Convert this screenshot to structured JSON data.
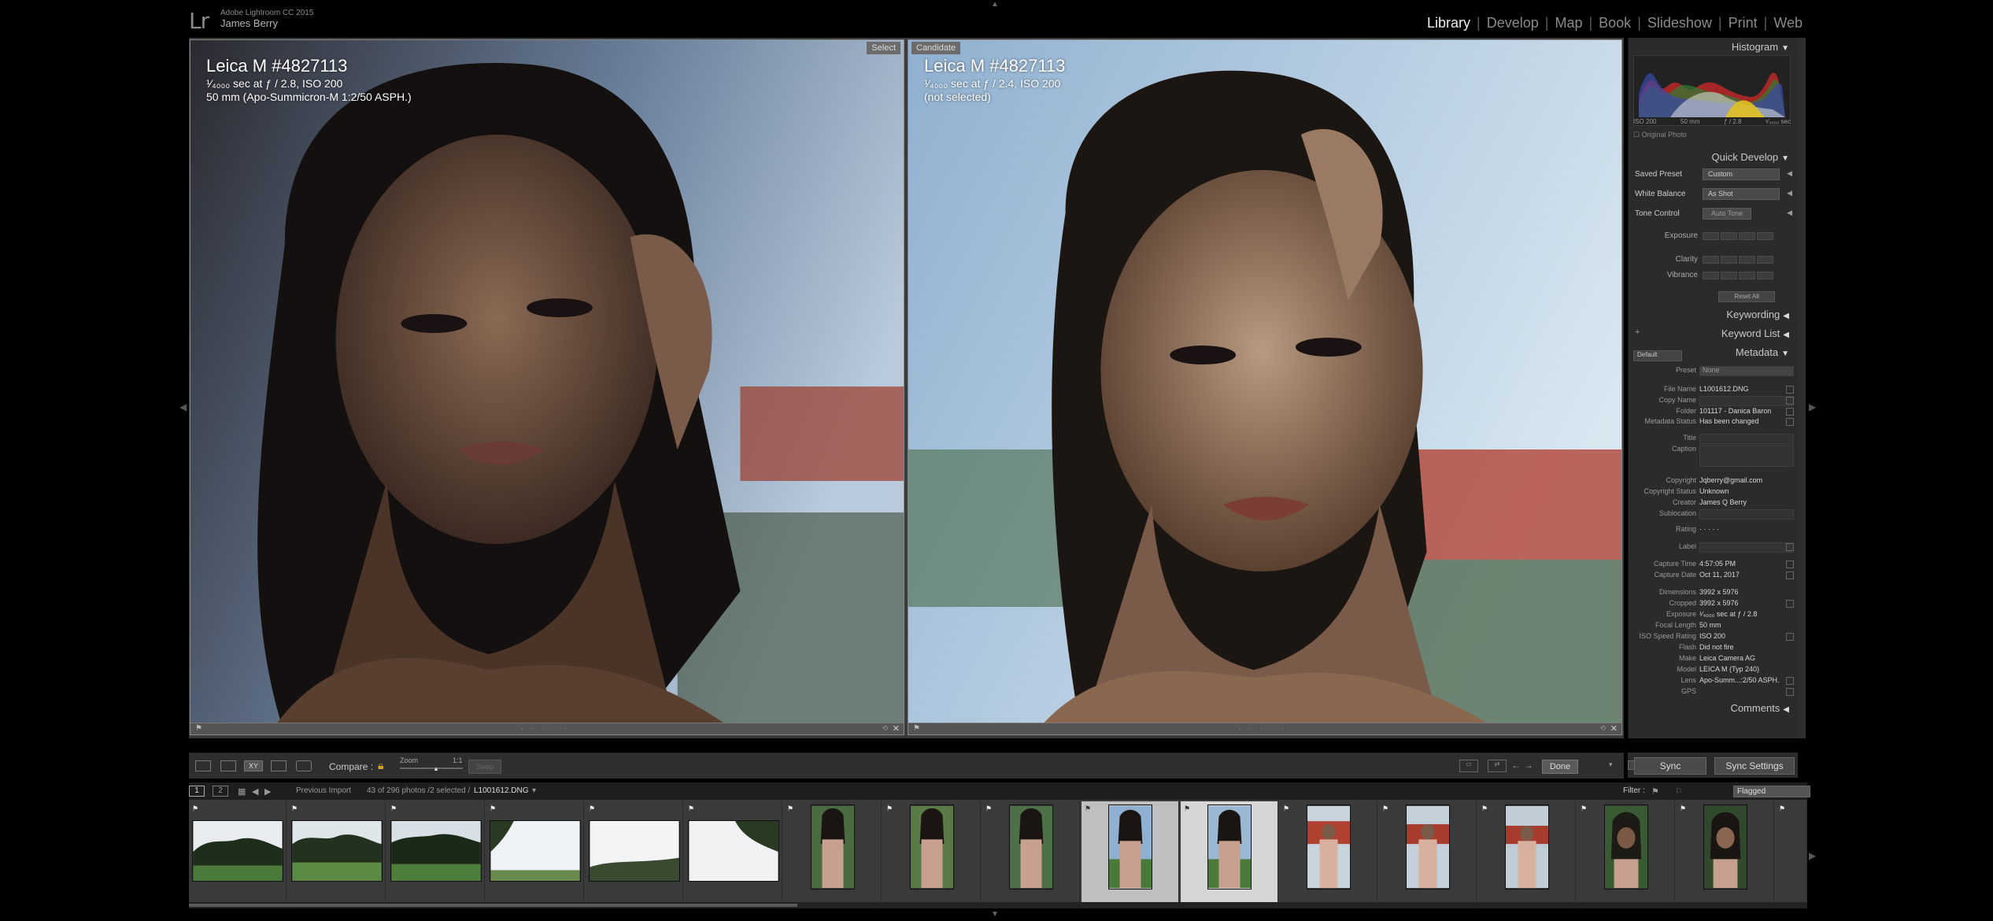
{
  "app": {
    "logo": "Lr",
    "name": "Adobe Lightroom CC 2015",
    "user": "James Berry"
  },
  "modules": [
    "Library",
    "Develop",
    "Map",
    "Book",
    "Slideshow",
    "Print",
    "Web"
  ],
  "active_module": "Library",
  "select_pane": {
    "tag": "Select",
    "camera": "Leica M #4827113",
    "exposure_line": "¹⁄₄₀₀₀ sec at ƒ / 2.8, ISO 200",
    "lens_line": "50 mm (Apo-Summicron-M 1:2/50 ASPH.)"
  },
  "candidate_pane": {
    "tag": "Candidate",
    "camera": "Leica M #4827113",
    "exposure_line": "¹⁄₄₀₀₀ sec at ƒ / 2.4, ISO 200",
    "status_line": "(not selected)"
  },
  "toolbar": {
    "compare_label": "Compare :",
    "zoom_label": "Zoom",
    "zoom_value": "1:1",
    "swap_label": "Swap",
    "done_label": "Done"
  },
  "right_panel": {
    "histogram": {
      "title": "Histogram",
      "iso": "ISO 200",
      "focal": "50 mm",
      "aperture": "ƒ / 2.8",
      "shutter": "¹⁄₄₀₀₀ sec",
      "original_photo": "Original Photo"
    },
    "quick_develop": {
      "title": "Quick Develop",
      "saved_preset_label": "Saved Preset",
      "saved_preset_value": "Custom",
      "white_balance_label": "White Balance",
      "white_balance_value": "As Shot",
      "tone_control_label": "Tone Control",
      "auto_tone": "Auto Tone",
      "exposure_label": "Exposure",
      "clarity_label": "Clarity",
      "vibrance_label": "Vibrance",
      "reset_all": "Reset All"
    },
    "keywording_title": "Keywording",
    "keyword_list_title": "Keyword List",
    "metadata": {
      "title": "Metadata",
      "preset_select": "Default",
      "preset_label": "Preset",
      "preset_value": "None",
      "fields": [
        {
          "k": "File Name",
          "v": "L1001612.DNG"
        },
        {
          "k": "Copy Name",
          "v": ""
        },
        {
          "k": "Folder",
          "v": "101117 - Danica Baron"
        },
        {
          "k": "Metadata Status",
          "v": "Has been changed"
        },
        {
          "k": "Title",
          "v": ""
        },
        {
          "k": "Caption",
          "v": ""
        },
        {
          "k": "Copyright",
          "v": "Jqberry@gmail.com"
        },
        {
          "k": "Copyright Status",
          "v": "Unknown"
        },
        {
          "k": "Creator",
          "v": "James Q Berry"
        },
        {
          "k": "Sublocation",
          "v": ""
        },
        {
          "k": "Rating",
          "v": "· · · · ·"
        },
        {
          "k": "Label",
          "v": ""
        },
        {
          "k": "Capture Time",
          "v": "4:57:05 PM"
        },
        {
          "k": "Capture Date",
          "v": "Oct 11, 2017"
        },
        {
          "k": "Dimensions",
          "v": "3992 x 5976"
        },
        {
          "k": "Cropped",
          "v": "3992 x 5976"
        },
        {
          "k": "Exposure",
          "v": "¹⁄₄₀₀₀ sec at ƒ / 2.8"
        },
        {
          "k": "Focal Length",
          "v": "50 mm"
        },
        {
          "k": "ISO Speed Rating",
          "v": "ISO 200"
        },
        {
          "k": "Flash",
          "v": "Did not fire"
        },
        {
          "k": "Make",
          "v": "Leica Camera AG"
        },
        {
          "k": "Model",
          "v": "LEICA M (Typ 240)"
        },
        {
          "k": "Lens",
          "v": "Apo-Summ...:2/50 ASPH."
        },
        {
          "k": "GPS",
          "v": ""
        }
      ]
    },
    "comments_title": "Comments",
    "sync_label": "Sync",
    "sync_settings_label": "Sync Settings"
  },
  "filmbar": {
    "page1": "1",
    "page2": "2",
    "source": "Previous Import",
    "count": "43 of 296 photos /2 selected /",
    "filename": "L1001612.DNG",
    "filter_label": "Filter :",
    "filter_value": "Flagged"
  },
  "colors": {
    "accent_lock": "#d9a520",
    "panel_bg": "#2b2b2b",
    "filmstrip_bg": "#3a3a3a"
  }
}
